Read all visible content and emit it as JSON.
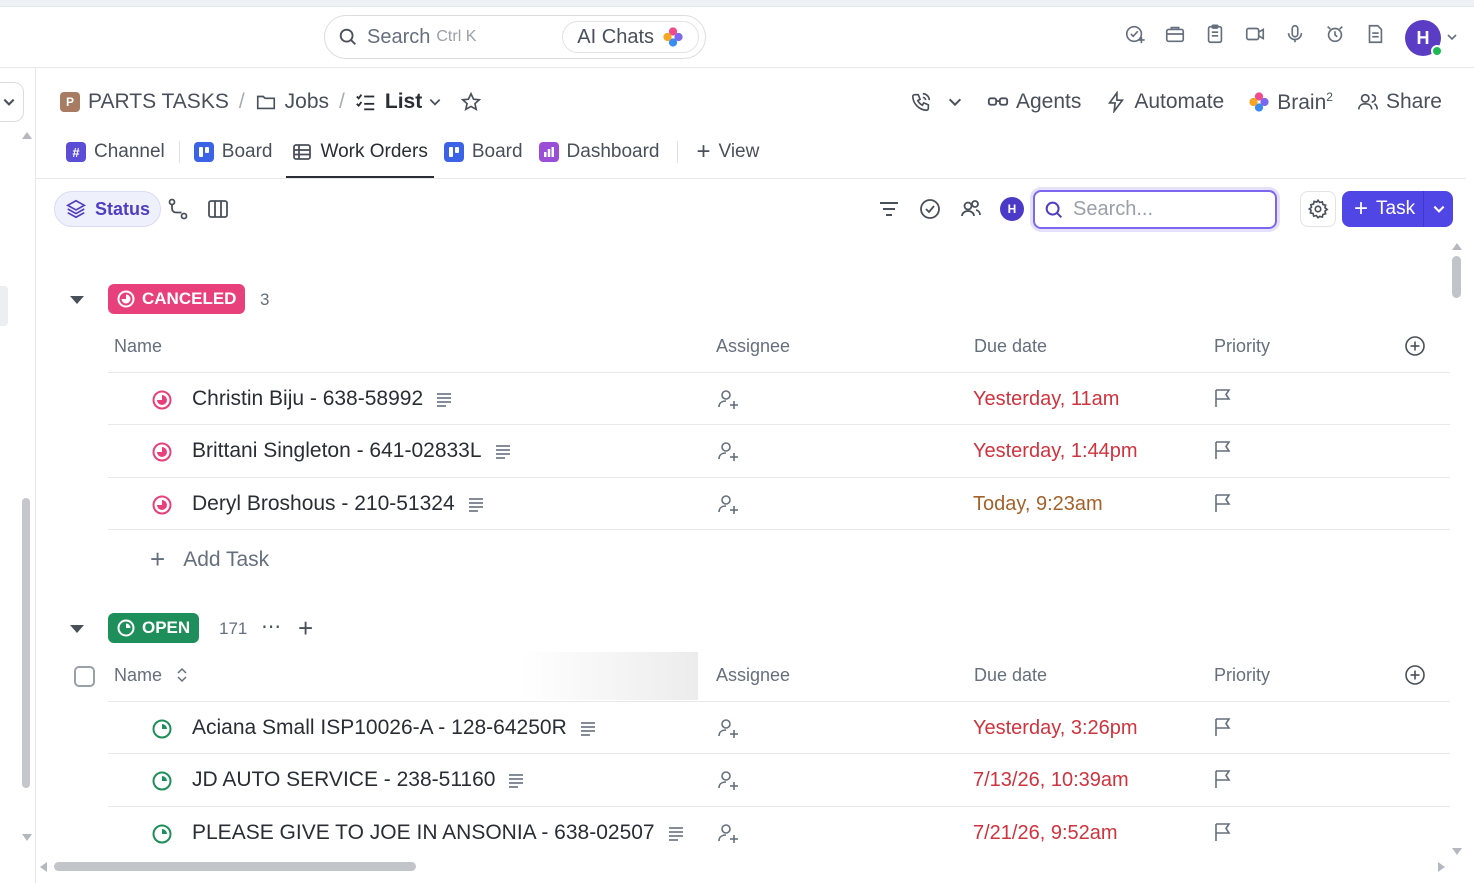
{
  "topbar": {
    "search_placeholder": "Search",
    "search_shortcut": "Ctrl K",
    "ai_chats_label": "AI Chats",
    "avatar_initial": "H"
  },
  "breadcrumb": {
    "space_initial": "P",
    "space": "PARTS TASKS",
    "folder": "Jobs",
    "list": "List"
  },
  "header_actions": {
    "agents": "Agents",
    "automate": "Automate",
    "brain": "Brain",
    "brain_sup": "2",
    "share": "Share"
  },
  "tabs": [
    {
      "label": "Channel",
      "icon": "hash-icon",
      "color": "#5b4dd6"
    },
    {
      "label": "Board",
      "icon": "board-icon",
      "color": "#3b63e6"
    },
    {
      "label": "Work Orders",
      "icon": "table-icon",
      "color": "#4a505a",
      "active": true
    },
    {
      "label": "Board",
      "icon": "board-icon",
      "color": "#3b63e6"
    },
    {
      "label": "Dashboard",
      "icon": "dashboard-icon",
      "color": "#9b4fd6"
    }
  ],
  "add_view_label": "View",
  "toolbar": {
    "group_by_label": "Status",
    "avatar_initial": "H",
    "search_placeholder": "Search...",
    "task_button_label": "Task"
  },
  "columns": {
    "name": "Name",
    "assignee": "Assignee",
    "due_date": "Due date",
    "priority": "Priority"
  },
  "groups": [
    {
      "status": "CANCELED",
      "color": "#e8407a",
      "count": "3",
      "tasks": [
        {
          "name": "Christin Biju - 638-58992",
          "due": "Yesterday, 11am",
          "due_color": "#d0333d"
        },
        {
          "name": "Brittani Singleton - 641-02833L",
          "due": "Yesterday, 1:44pm",
          "due_color": "#d0333d"
        },
        {
          "name": "Deryl Broshous - 210-51324",
          "due": "Today, 9:23am",
          "due_color": "#a4622a"
        }
      ],
      "add_task_label": "Add Task"
    },
    {
      "status": "OPEN",
      "color": "#1e8f5a",
      "count": "171",
      "tasks": [
        {
          "name": "Aciana Small ISP10026-A - 128-64250R",
          "due": "Yesterday, 3:26pm",
          "due_color": "#d0333d"
        },
        {
          "name": "JD AUTO SERVICE - 238-51160",
          "due": "7/13/26, 10:39am",
          "due_color": "#d0333d"
        },
        {
          "name": "PLEASE GIVE TO JOE IN ANSONIA - 638-02507",
          "due": "7/21/26, 9:52am",
          "due_color": "#d0333d"
        }
      ]
    }
  ]
}
